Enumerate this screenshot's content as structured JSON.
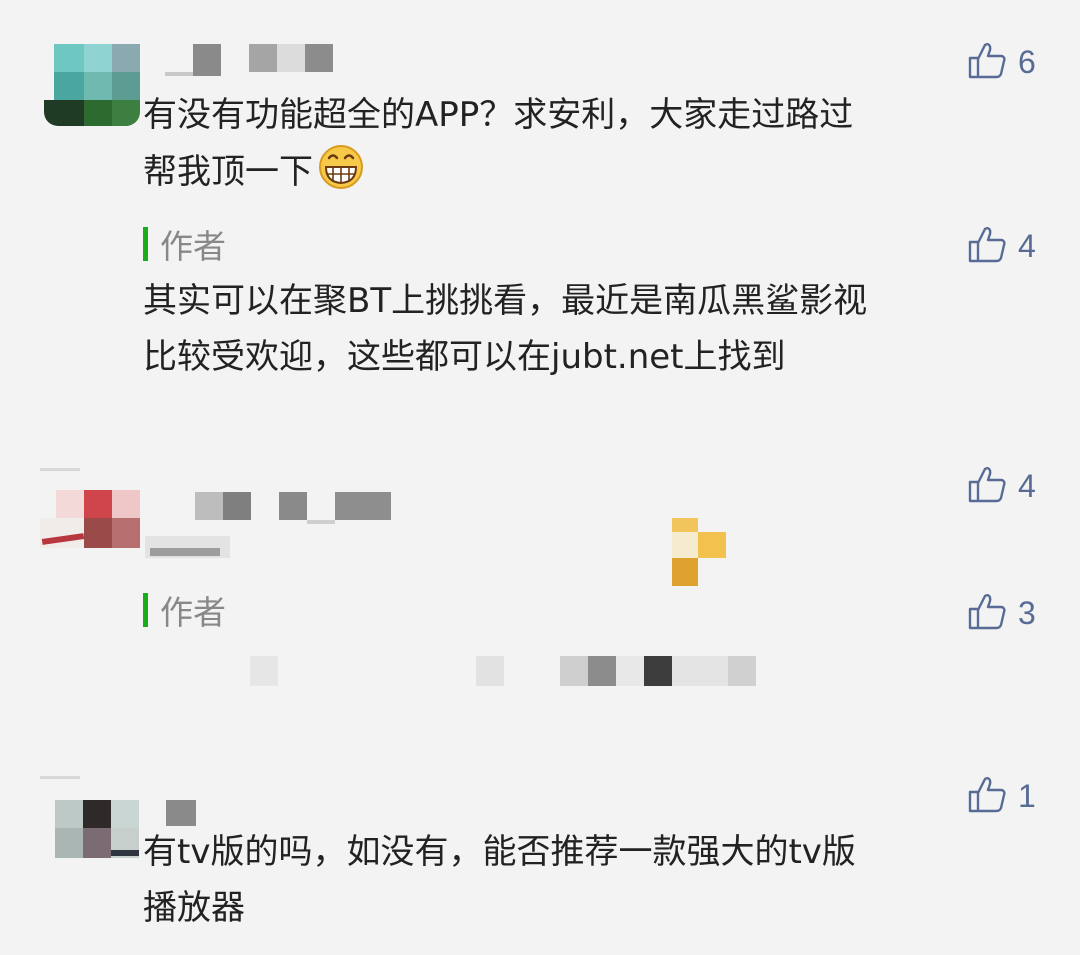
{
  "comments": [
    {
      "text": "有没有功能超全的APP？求安利，大家走过路过\n帮我顶一下",
      "likes": "6",
      "reply": {
        "author_label": "作者",
        "text": "其实可以在聚BT上挑挑看，最近是南瓜黑鲨影视\n比较受欢迎，这些都可以在jubt.net上找到",
        "likes": "4"
      }
    },
    {
      "likes": "4",
      "reply": {
        "author_label": "作者",
        "likes": "3"
      }
    },
    {
      "text": "有tv版的吗，如没有，能否推荐一款强大的tv版\n播放器",
      "likes": "1"
    }
  ],
  "icons": {
    "like": "thumbs-up-icon",
    "emoji": "grinning-face-icon"
  },
  "colors": {
    "background": "#f3f3f3",
    "accent_green": "#1aad19",
    "link_blue": "#576b95",
    "text": "#222222",
    "muted": "#888888"
  }
}
